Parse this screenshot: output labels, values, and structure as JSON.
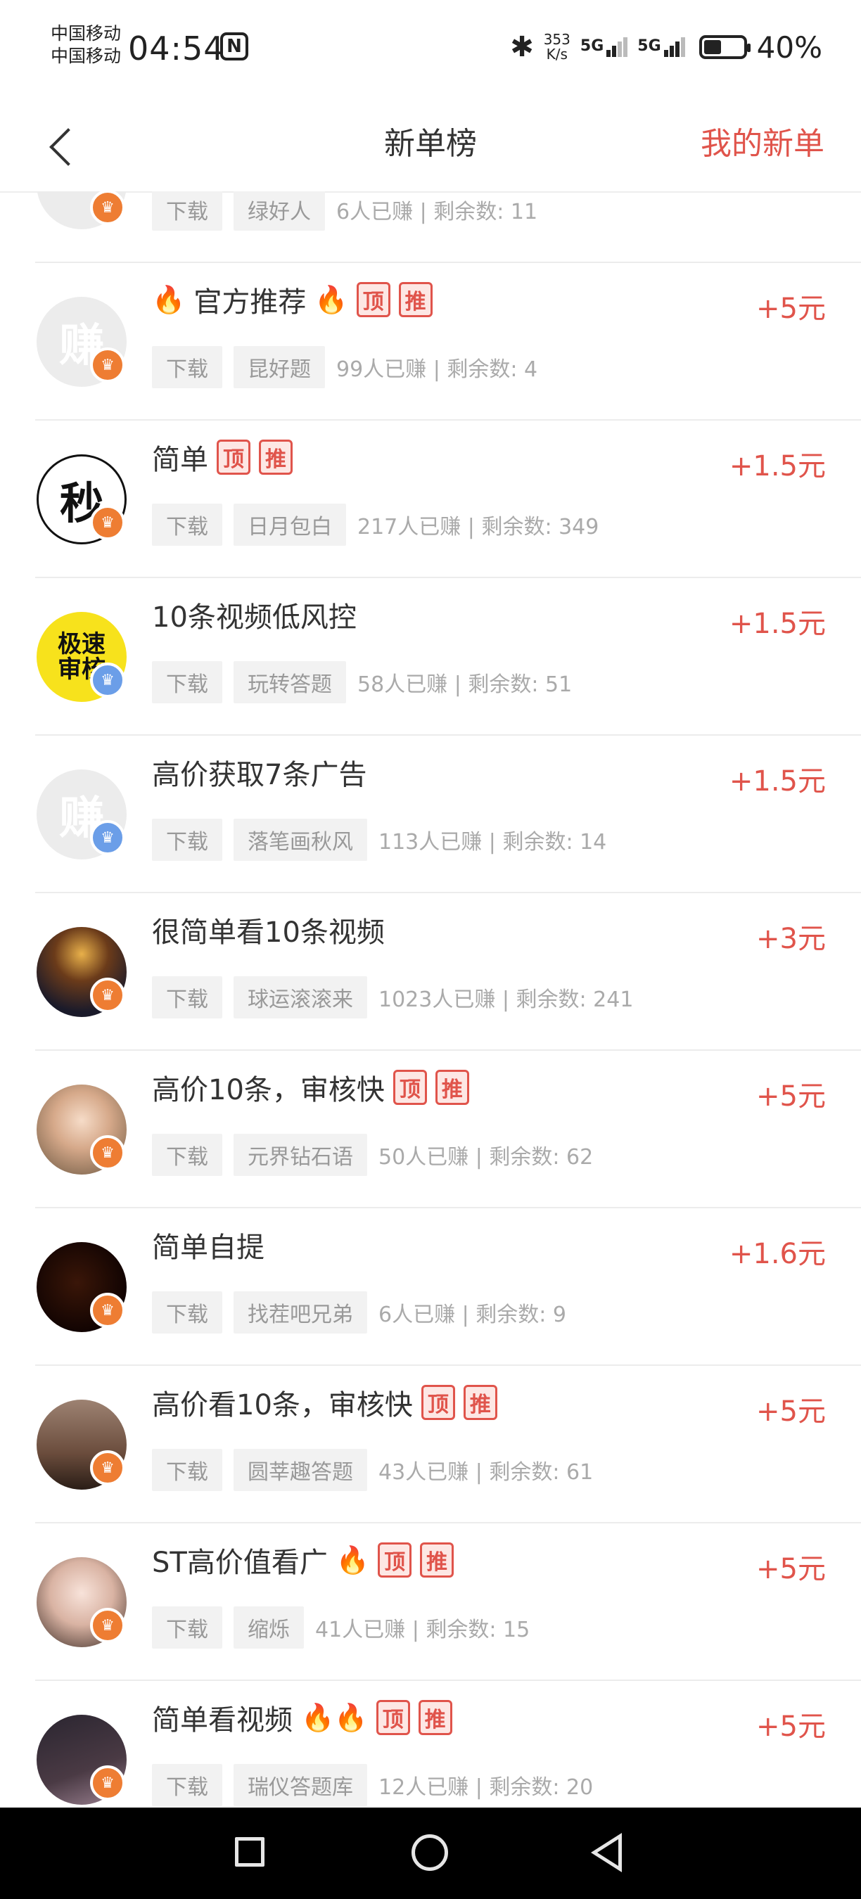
{
  "status_bar": {
    "carrier1": "中国移动",
    "carrier2": "中国移动",
    "time": "04:54",
    "nfc": "N",
    "speed_value": "353",
    "speed_unit": "K/s",
    "net1": "5G",
    "net2": "5G",
    "battery_percent": "40%"
  },
  "nav": {
    "title": "新单榜",
    "right_link": "我的新单"
  },
  "badges": {
    "top": "顶",
    "recommend": "推"
  },
  "items": [
    {
      "title": "",
      "tag_download": "下载",
      "publisher": "绿好人",
      "stats": "6人已赚 | 剩余数: 11",
      "reward": "",
      "avatar": "default",
      "crown": "gold"
    },
    {
      "title": "官方推荐",
      "fire_before": "🔥",
      "fire_after": "🔥",
      "tag_download": "下载",
      "publisher": "昆好题",
      "stats": "99人已赚 | 剩余数: 4",
      "reward": "+5元",
      "avatar": "default",
      "avatar_text": "赚",
      "crown": "gold",
      "badges": true
    },
    {
      "title": "简单",
      "tag_download": "下载",
      "publisher": "日月包白",
      "stats": "217人已赚 | 剩余数: 349",
      "reward": "+1.5元",
      "avatar": "秒",
      "crown": "gold",
      "badges": true
    },
    {
      "title": "10条视频低风控",
      "tag_download": "下载",
      "publisher": "玩转答题",
      "stats": "58人已赚 | 剩余数: 51",
      "reward": "+1.5元",
      "avatar": "极速审核",
      "crown": "blue"
    },
    {
      "title": "高价获取7条广告",
      "tag_download": "下载",
      "publisher": "落笔画秋风",
      "stats": "113人已赚 | 剩余数: 14",
      "reward": "+1.5元",
      "avatar": "default",
      "avatar_text": "赚",
      "crown": "blue"
    },
    {
      "title": "很简单看10条视频",
      "tag_download": "下载",
      "publisher": "球运滚滚来",
      "stats": "1023人已赚 | 剩余数: 241",
      "reward": "+3元",
      "avatar": "photo-night",
      "crown": "gold"
    },
    {
      "title": "高价10条，审核快",
      "tag_download": "下载",
      "publisher": "元界钻石语",
      "stats": "50人已赚 | 剩余数: 62",
      "reward": "+5元",
      "avatar": "photo-girl",
      "crown": "gold",
      "badges": true
    },
    {
      "title": "简单自提",
      "tag_download": "下载",
      "publisher": "找茬吧兄弟",
      "stats": "6人已赚 | 剩余数: 9",
      "reward": "+1.6元",
      "avatar": "photo-dark",
      "crown": "gold"
    },
    {
      "title": "高价看10条，审核快",
      "tag_download": "下载",
      "publisher": "圆莘趣答题",
      "stats": "43人已赚 | 剩余数: 61",
      "reward": "+5元",
      "avatar": "photo-sunset",
      "crown": "gold",
      "badges": true
    },
    {
      "title": "ST高价值看广",
      "fire_after": "🔥",
      "tag_download": "下载",
      "publisher": "缩烁",
      "stats": "41人已赚 | 剩余数: 15",
      "reward": "+5元",
      "avatar": "photo-lady",
      "crown": "gold",
      "badges": true
    },
    {
      "title": "简单看视频",
      "fire_after": "🔥🔥",
      "tag_download": "下载",
      "publisher": "瑞仪答题库",
      "stats": "12人已赚 | 剩余数: 20",
      "reward": "+5元",
      "avatar": "photo-calligraphy",
      "crown": "gold",
      "badges": true
    }
  ],
  "colors": {
    "accent": "#e0544b",
    "badge_bg": "#fde7e4",
    "crown_gold": "#ee7d33",
    "crown_blue": "#6b9ee8"
  },
  "bottom_nav": {
    "icons": [
      "recent-apps-icon",
      "home-icon",
      "back-icon"
    ]
  }
}
